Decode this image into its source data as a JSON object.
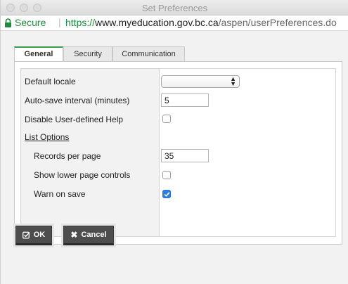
{
  "window": {
    "title": "Set Preferences"
  },
  "address": {
    "secure_label": "Secure",
    "url_scheme": "https://",
    "url_host": "www.myeducation.gov.bc.ca",
    "url_path": "/aspen/userPreferences.do"
  },
  "tabs": [
    {
      "label": "General",
      "active": true
    },
    {
      "label": "Security",
      "active": false
    },
    {
      "label": "Communication",
      "active": false
    }
  ],
  "form": {
    "default_locale": {
      "label": "Default locale",
      "value": ""
    },
    "autosave": {
      "label": "Auto-save interval (minutes)",
      "value": "5"
    },
    "disable_help": {
      "label": "Disable User-defined Help",
      "checked": false
    },
    "list_options": {
      "label": "List Options"
    },
    "records_per_page": {
      "label": "Records per page",
      "value": "35"
    },
    "show_lower_controls": {
      "label": "Show lower page controls",
      "checked": false
    },
    "warn_on_save": {
      "label": "Warn on save",
      "checked": true
    }
  },
  "buttons": {
    "ok": {
      "label": "OK",
      "icon": "check-square-icon"
    },
    "cancel": {
      "label": "Cancel",
      "icon": "x-icon"
    }
  },
  "colors": {
    "secure_green": "#1e8a3a",
    "tab_accent": "#3b9b4a",
    "checkbox_blue": "#2f7de1",
    "button_dark": "#4d4d4d"
  }
}
